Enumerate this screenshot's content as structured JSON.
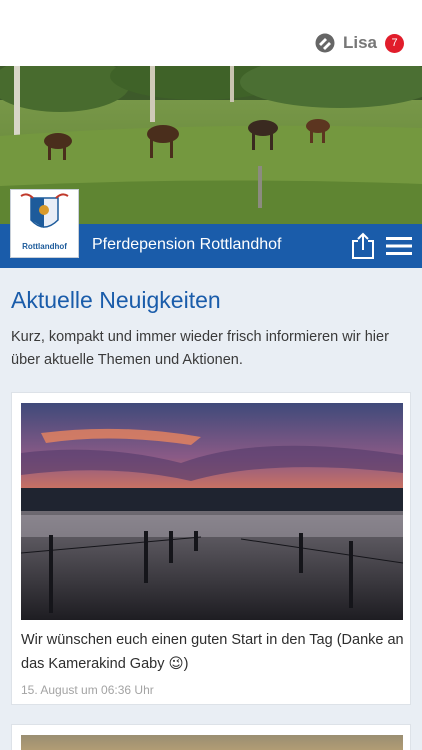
{
  "header": {
    "user_name": "Lisa",
    "notification_count": "7"
  },
  "brand": {
    "title": "Pferdepension Rottlandhof",
    "logo_text": "Rottlandhof",
    "accent_color": "#1a5caa"
  },
  "main": {
    "title": "Aktuelle Neuigkeiten",
    "intro": "Kurz, kompakt und immer wieder frisch informieren wir hier über aktuelle Themen und Aktionen.",
    "posts": [
      {
        "text": "Wir wünschen euch einen guten Start in den Tag (Danke an das Kamerakind Gaby 😉)",
        "date": "15. August um 06:36 Uhr"
      }
    ]
  },
  "icons": {
    "user": "user-status-icon",
    "share": "share-icon",
    "menu": "hamburger-menu-icon"
  }
}
